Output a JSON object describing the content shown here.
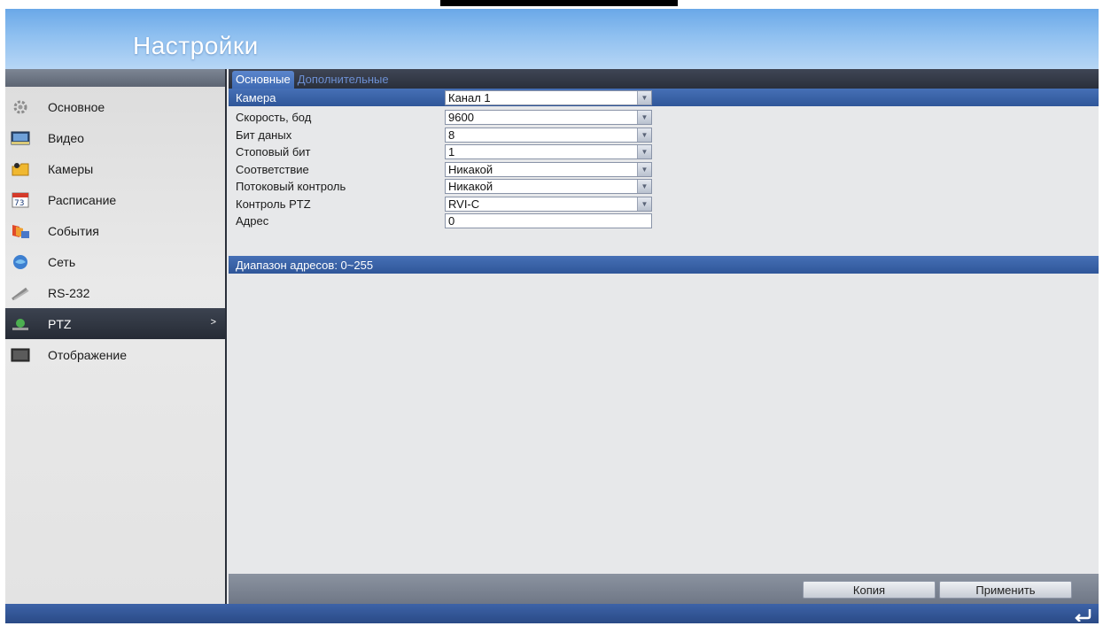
{
  "title": "Настройки",
  "sidebar": {
    "items": [
      {
        "label": "Основное",
        "icon": "gear-icon"
      },
      {
        "label": "Видео",
        "icon": "video-icon"
      },
      {
        "label": "Камеры",
        "icon": "camera-icon"
      },
      {
        "label": "Расписание",
        "icon": "calendar-icon"
      },
      {
        "label": "События",
        "icon": "events-icon"
      },
      {
        "label": "Сеть",
        "icon": "network-icon"
      },
      {
        "label": "RS-232",
        "icon": "rs232-icon"
      },
      {
        "label": "PTZ",
        "icon": "ptz-icon",
        "active": true
      },
      {
        "label": "Отображение",
        "icon": "display-icon"
      }
    ]
  },
  "tabs": [
    {
      "label": "Основные",
      "active": true
    },
    {
      "label": "Дополнительные",
      "active": false
    }
  ],
  "form": {
    "camera": {
      "label": "Камера",
      "value": "Канал 1"
    },
    "baud": {
      "label": "Скорость, бод",
      "value": "9600"
    },
    "databits": {
      "label": "Бит даных",
      "value": "8"
    },
    "stopbit": {
      "label": "Стоповый бит",
      "value": "1"
    },
    "parity": {
      "label": "Соответствие",
      "value": "Никакой"
    },
    "flow": {
      "label": "Потоковый контроль",
      "value": "Никакой"
    },
    "ptz": {
      "label": "Контроль PTZ",
      "value": "RVI-C"
    },
    "address": {
      "label": "Адрес",
      "value": "0"
    }
  },
  "hint": "Диапазон адресов: 0~255",
  "buttons": {
    "copy": "Копия",
    "apply": "Применить"
  },
  "colors": {
    "accent": "#3f6ab3",
    "title_bar": "#8fc0f0"
  }
}
